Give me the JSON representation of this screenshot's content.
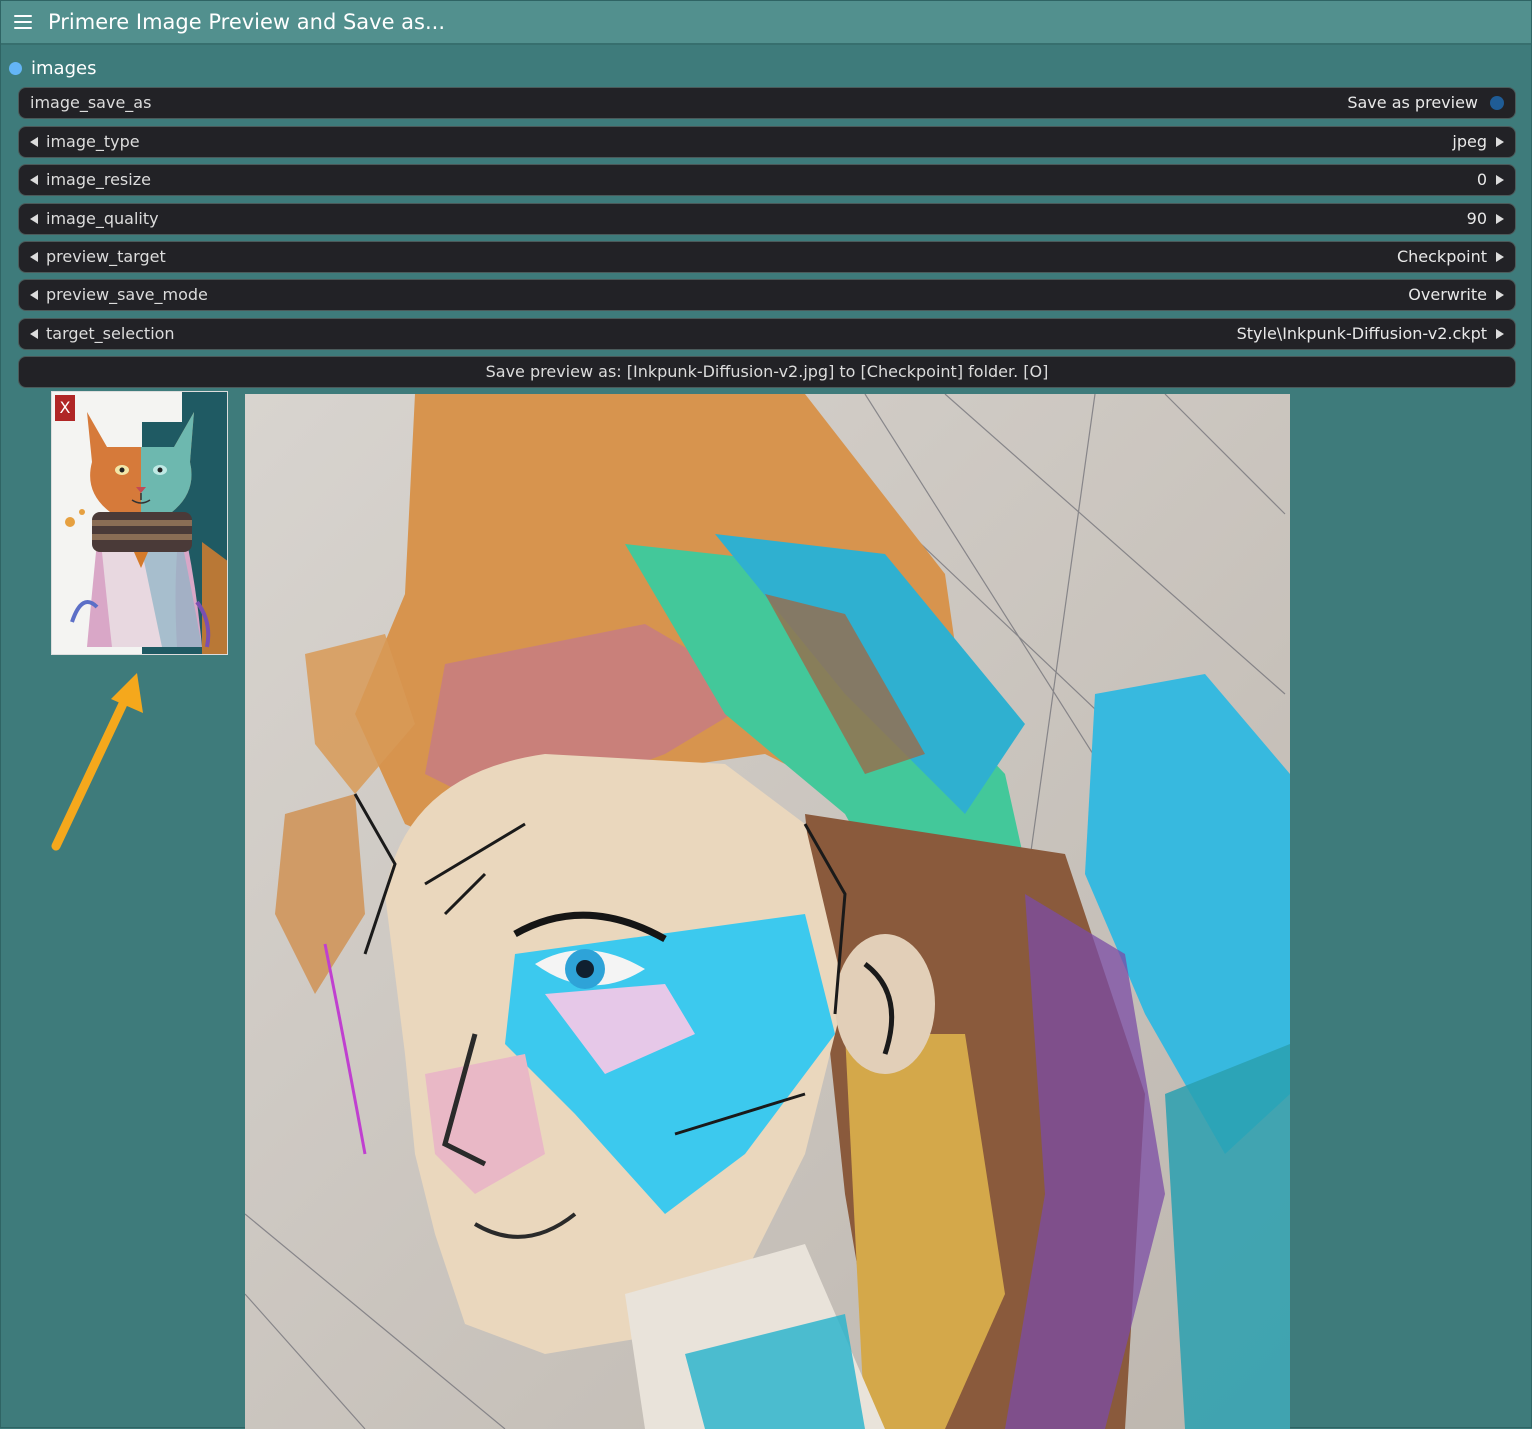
{
  "node": {
    "title": "Primere Image Preview and Save as...",
    "menu_icon": "hamburger-menu-icon",
    "title_bar_color": "#52908e",
    "body_color": "#3e7b7b"
  },
  "output": {
    "label": "images",
    "dot_color": "#64b5f6"
  },
  "widgets": {
    "image_save_as": {
      "label": "image_save_as",
      "value": "Save as preview",
      "toggle_color": "#1f5c96"
    },
    "image_type": {
      "label": "image_type",
      "value": "jpeg"
    },
    "image_resize": {
      "label": "image_resize",
      "value": "0"
    },
    "image_quality": {
      "label": "image_quality",
      "value": "90"
    },
    "preview_target": {
      "label": "preview_target",
      "value": "Checkpoint"
    },
    "preview_save_mode": {
      "label": "preview_save_mode",
      "value": "Overwrite"
    },
    "target_selection": {
      "label": "target_selection",
      "value": "Style\\Inkpunk-Diffusion-v2.ckpt"
    }
  },
  "info_text": "Save preview as: [Inkpunk-Diffusion-v2.jpg] to [Checkpoint] folder. [O]",
  "thumbnail": {
    "close_label": "X",
    "close_color": "#b02626",
    "subject": "cat illustration"
  },
  "preview": {
    "subject": "inkpunk portrait"
  },
  "annotation": {
    "icon": "arrow-icon",
    "color": "#f5a81c"
  }
}
